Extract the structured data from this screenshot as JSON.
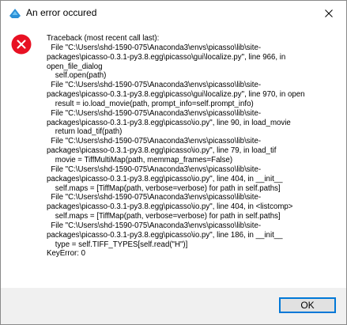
{
  "window": {
    "title": "An error occured",
    "app_icon": "python-app-icon",
    "close_icon": "close-icon"
  },
  "dialog": {
    "icon": "error-icon",
    "icon_color": "#e81123",
    "message_lines": [
      "Traceback (most recent call last):",
      "  File \"C:\\Users\\shd-1590-075\\Anaconda3\\envs\\picasso\\lib\\site-",
      "packages\\picasso-0.3.1-py3.8.egg\\picasso\\gui\\localize.py\", line 966, in",
      "open_file_dialog",
      "    self.open(path)",
      "  File \"C:\\Users\\shd-1590-075\\Anaconda3\\envs\\picasso\\lib\\site-",
      "packages\\picasso-0.3.1-py3.8.egg\\picasso\\gui\\localize.py\", line 970, in open",
      "    result = io.load_movie(path, prompt_info=self.prompt_info)",
      "  File \"C:\\Users\\shd-1590-075\\Anaconda3\\envs\\picasso\\lib\\site-",
      "packages\\picasso-0.3.1-py3.8.egg\\picasso\\io.py\", line 90, in load_movie",
      "    return load_tif(path)",
      "  File \"C:\\Users\\shd-1590-075\\Anaconda3\\envs\\picasso\\lib\\site-",
      "packages\\picasso-0.3.1-py3.8.egg\\picasso\\io.py\", line 79, in load_tif",
      "    movie = TiffMultiMap(path, memmap_frames=False)",
      "  File \"C:\\Users\\shd-1590-075\\Anaconda3\\envs\\picasso\\lib\\site-",
      "packages\\picasso-0.3.1-py3.8.egg\\picasso\\io.py\", line 404, in __init__",
      "    self.maps = [TiffMap(path, verbose=verbose) for path in self.paths]",
      "  File \"C:\\Users\\shd-1590-075\\Anaconda3\\envs\\picasso\\lib\\site-",
      "packages\\picasso-0.3.1-py3.8.egg\\picasso\\io.py\", line 404, in <listcomp>",
      "    self.maps = [TiffMap(path, verbose=verbose) for path in self.paths]",
      "  File \"C:\\Users\\shd-1590-075\\Anaconda3\\envs\\picasso\\lib\\site-",
      "packages\\picasso-0.3.1-py3.8.egg\\picasso\\io.py\", line 186, in __init__",
      "    type = self.TIFF_TYPES[self.read(\"H\")]",
      "KeyError: 0"
    ]
  },
  "buttons": {
    "ok_label": "OK"
  }
}
